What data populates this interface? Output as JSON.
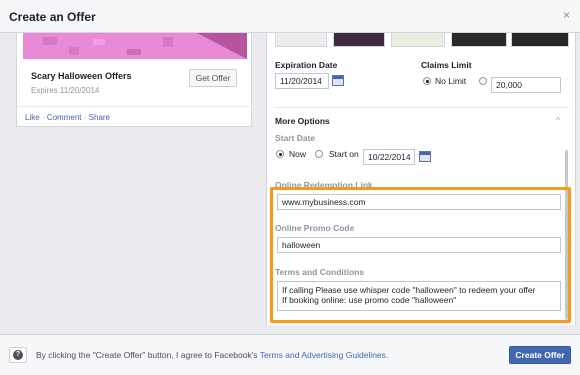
{
  "dialog": {
    "title": "Create an Offer",
    "close": "×"
  },
  "preview": {
    "offer_title": "Scary Halloween Offers",
    "expires": "Expires 11/20/2014",
    "get_offer": "Get Offer",
    "actions": {
      "like": "Like",
      "comment": "Comment",
      "share": "Share",
      "separator": "·"
    }
  },
  "form": {
    "expiration_label": "Expiration Date",
    "expiration_value": "11/20/2014",
    "claims_label": "Claims Limit",
    "no_limit": "No Limit",
    "claims_value": "20,000",
    "more_options": "More Options",
    "more_options_chevron": "^",
    "start_date_label": "Start Date",
    "start_now": "Now",
    "start_on": "Start on",
    "start_on_value": "10/22/2014",
    "redemption_label": "Online Redemption Link",
    "redemption_value": "www.mybusiness.com",
    "promo_label": "Online Promo Code",
    "promo_value": "halloween",
    "terms_label": "Terms and Conditions",
    "terms_line1": "If calling Please use whisper code \"halloween\" to redeem your offer",
    "terms_line2": "If booking online: use promo code \"halloween\""
  },
  "footer": {
    "help_icon": "?",
    "disclaimer_prefix": "By clicking the \"Create Offer\" button, I agree to Facebook's",
    "disclaimer_link": "Terms and Advertising Guidelines",
    "disclaimer_suffix": ".",
    "create_button": "Create Offer"
  },
  "colors": {
    "brand_blue": "#4267b2",
    "highlight_orange": "#f49a1e",
    "preview_pink": "#e88ad6"
  }
}
